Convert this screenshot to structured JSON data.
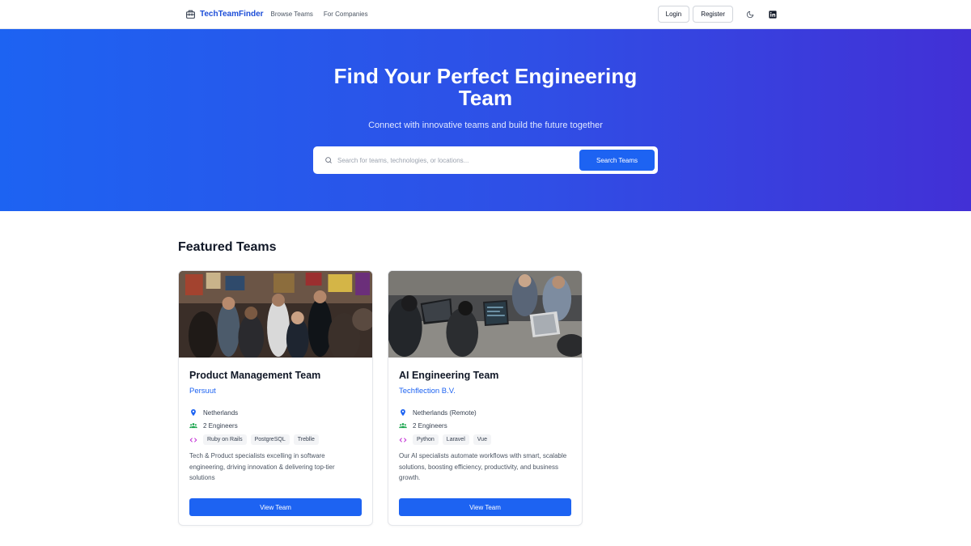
{
  "header": {
    "brand": "TechTeamFinder",
    "nav": [
      "Browse Teams",
      "For Companies"
    ],
    "login_label": "Login",
    "register_label": "Register"
  },
  "hero": {
    "title_line1": "Find Your Perfect Engineering",
    "title_line2": "Team",
    "subtitle": "Connect with innovative teams and build the future together",
    "search_placeholder": "Search for teams, technologies, or locations...",
    "search_button": "Search Teams"
  },
  "featured": {
    "title": "Featured Teams",
    "cards": [
      {
        "title": "Product Management Team",
        "company": "Persuut",
        "location": "Netherlands",
        "engineers": "2 Engineers",
        "tags": [
          "Ruby on Rails",
          "PostgreSQL",
          "Treblle"
        ],
        "description": "Tech & Product specialists excelling in software engineering, driving innovation & delivering top-tier solutions",
        "button": "View Team"
      },
      {
        "title": "AI Engineering Team",
        "company": "Techflection B.V.",
        "location": "Netherlands (Remote)",
        "engineers": "2 Engineers",
        "tags": [
          "Python",
          "Laravel",
          "Vue"
        ],
        "description": "Our AI specialists automate workflows with smart, scalable solutions, boosting efficiency, productivity, and business growth.",
        "button": "View Team"
      }
    ]
  },
  "colors": {
    "primary": "#1d63f2",
    "hero_gradient_start": "#1d63f2",
    "hero_gradient_end": "#4230d6",
    "location_icon": "#1d63f2",
    "engineers_icon": "#16a34a",
    "code_icon": "#c026d3"
  },
  "icons": {
    "brand": "briefcase-icon",
    "theme": "moon-icon",
    "social": "linkedin-icon",
    "search": "search-icon",
    "location": "map-pin-icon",
    "engineers": "users-icon",
    "tech": "code-icon"
  }
}
